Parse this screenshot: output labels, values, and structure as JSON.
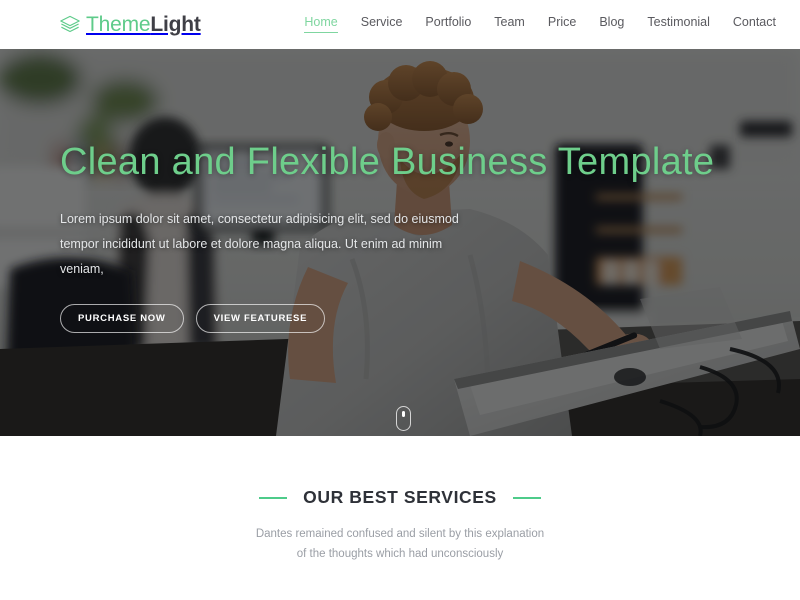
{
  "brand": {
    "icon": "layers-stack-icon",
    "name_primary": "Theme",
    "name_secondary": "Light",
    "primary_color": "#5ecb8a",
    "secondary_color": "#3f3f46"
  },
  "nav": {
    "items": [
      {
        "label": "Home",
        "active": true
      },
      {
        "label": "Service",
        "active": false
      },
      {
        "label": "Portfolio",
        "active": false
      },
      {
        "label": "Team",
        "active": false
      },
      {
        "label": "Price",
        "active": false
      },
      {
        "label": "Blog",
        "active": false
      },
      {
        "label": "Testimonial",
        "active": false
      },
      {
        "label": "Contact",
        "active": false
      }
    ]
  },
  "hero": {
    "title": "Clean and Flexible Business Template",
    "title_color": "#6ece8b",
    "subtitle_line1": "Lorem ipsum dolor sit amet, consectetur adipisicing elit, sed do eiusmod",
    "subtitle_line2": "tempor incididunt ut labore et dolore magna aliqua. Ut enim ad minim veniam,",
    "buttons": [
      {
        "label": "PURCHASE NOW"
      },
      {
        "label": "VIEW FEATURESE"
      }
    ],
    "scroll_indicator_icon": "mouse-scroll-icon",
    "background_description": "office photo of man in grey t-shirt drawing on a graphics tablet"
  },
  "services": {
    "heading": "OUR BEST SERVICES",
    "heading_color": "#2e3138",
    "accent_color": "#4ecb8a",
    "subtitle_line1": "Dantes remained confused and silent by this explanation of the",
    "subtitle_line2": "thoughts which had unconsciously"
  }
}
